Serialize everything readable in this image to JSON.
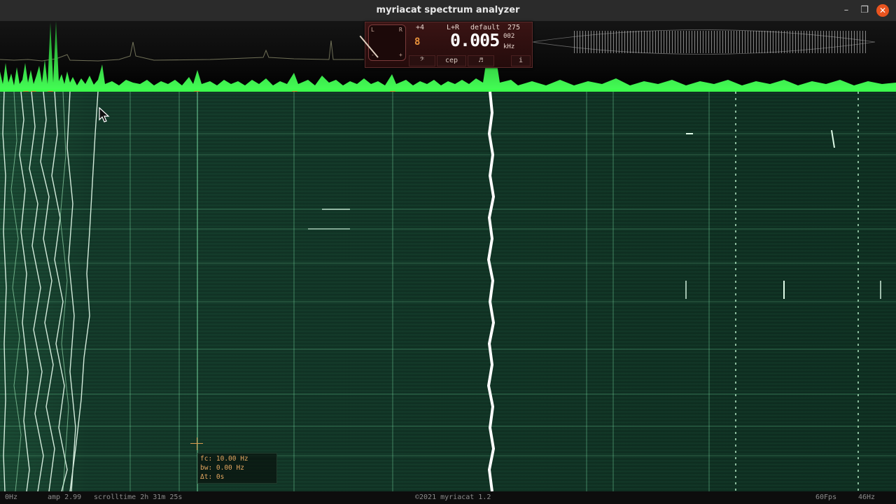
{
  "window": {
    "title": "myriacat spectrum analyzer",
    "controls": {
      "minimize": "–",
      "maximize": "❐",
      "close": "✕"
    }
  },
  "panel": {
    "channel_offset": "+4",
    "channel": "L+R",
    "preset": "default",
    "preset_value": "275",
    "frequency": "0.005",
    "frequency_unit": "kHz",
    "frequency_sub": "002",
    "segment_display": "8",
    "dial_labels": {
      "left": "L",
      "right": "R",
      "minus": "-",
      "plus": "+"
    },
    "tabs": [
      {
        "label": "𝄢"
      },
      {
        "label": "cep"
      },
      {
        "label": "♬"
      },
      {
        "label": "i"
      }
    ]
  },
  "cursor_info": {
    "fc": "fc: 10.00 Hz",
    "bw": "bw: 0.00 Hz",
    "dt": "Δt: 0s"
  },
  "status": {
    "left_freq": "0Hz",
    "amp": "amp 2.99",
    "scrolltime": "scrolltime 2h 31m 25s",
    "copyright": "©2021 myriacat 1.2",
    "fps": "60Fps",
    "right_freq": "46Hz"
  },
  "colors": {
    "spectrum_green": "#2fe04a",
    "waterfall_bg": "#143a2a",
    "trace_white": "#ffffff",
    "marker_orange": "#d89a3a",
    "panel_bg": "#2e1010",
    "close_button": "#e9541f"
  }
}
